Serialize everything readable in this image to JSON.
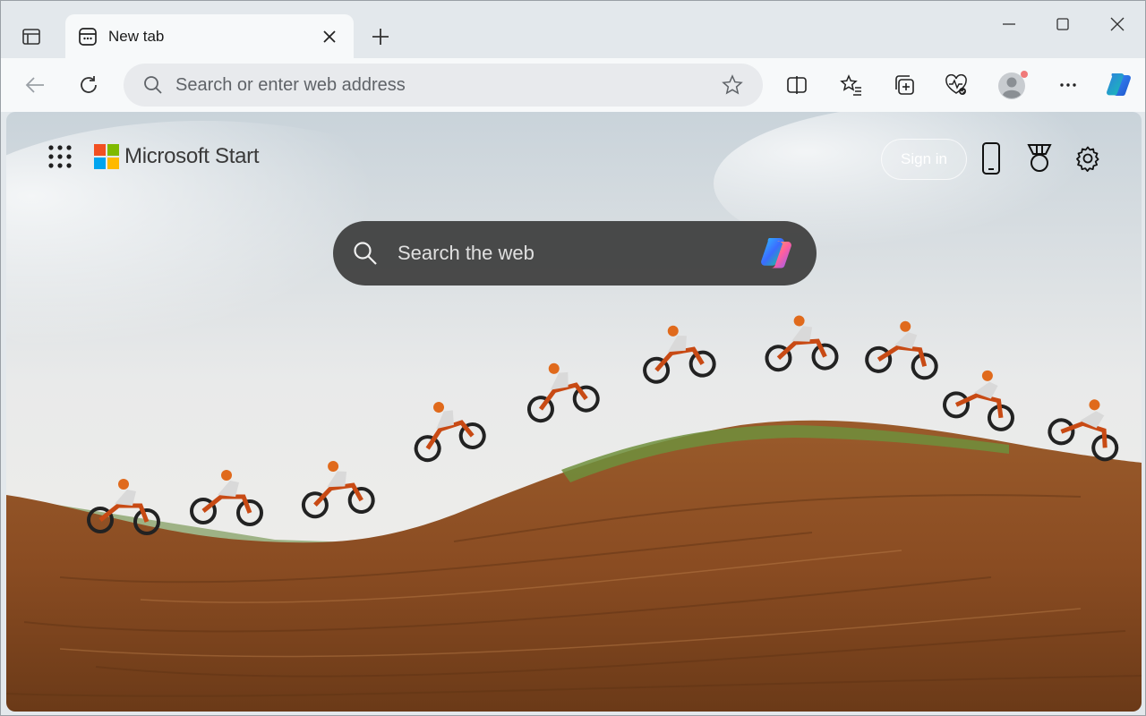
{
  "browser": {
    "tab": {
      "title": "New tab"
    },
    "address_bar": {
      "placeholder": "Search or enter web address"
    }
  },
  "page": {
    "brand": "Microsoft Start",
    "signin_label": "Sign in",
    "search": {
      "placeholder": "Search the web"
    }
  },
  "colors": {
    "ms_red": "#f25022",
    "ms_green": "#7fba00",
    "ms_blue": "#00a4ef",
    "ms_yellow": "#ffb900"
  }
}
